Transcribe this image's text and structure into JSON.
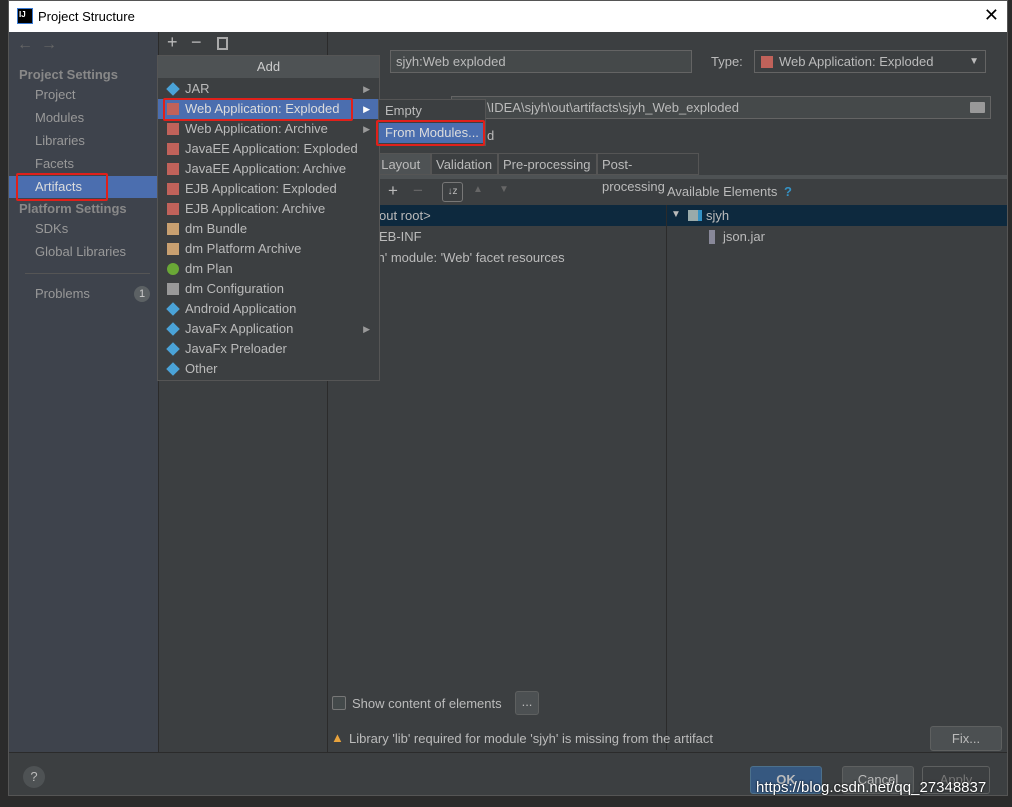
{
  "window": {
    "title": "Project Structure",
    "close": "✕"
  },
  "sidebar": {
    "project_settings": "Project Settings",
    "items": [
      "Project",
      "Modules",
      "Libraries",
      "Facets",
      "Artifacts"
    ],
    "platform_settings": "Platform Settings",
    "platform_items": [
      "SDKs",
      "Global Libraries"
    ],
    "problems": "Problems",
    "problems_count": "1"
  },
  "menu": {
    "header": "Add",
    "items": [
      {
        "label": "JAR",
        "icon": "jar-icon",
        "arrow": true
      },
      {
        "label": "Web Application: Exploded",
        "icon": "web-app-icon",
        "arrow": true
      },
      {
        "label": "Web Application: Archive",
        "icon": "web-app-icon",
        "arrow": true
      },
      {
        "label": "JavaEE Application: Exploded",
        "icon": "javaee-icon"
      },
      {
        "label": "JavaEE Application: Archive",
        "icon": "javaee-icon"
      },
      {
        "label": "EJB Application: Exploded",
        "icon": "ejb-icon"
      },
      {
        "label": "EJB Application: Archive",
        "icon": "ejb-icon"
      },
      {
        "label": "dm Bundle",
        "icon": "dm-bundle-icon"
      },
      {
        "label": "dm Platform Archive",
        "icon": "dm-archive-icon"
      },
      {
        "label": "dm Plan",
        "icon": "dm-plan-icon"
      },
      {
        "label": "dm Configuration",
        "icon": "file-icon"
      },
      {
        "label": "Android Application",
        "icon": "jar-icon"
      },
      {
        "label": "JavaFx Application",
        "icon": "jar-icon",
        "arrow": true
      },
      {
        "label": "JavaFx Preloader",
        "icon": "jar-icon"
      },
      {
        "label": "Other",
        "icon": "jar-icon"
      }
    ],
    "submenu": [
      "Empty",
      "From Modules..."
    ]
  },
  "artifact": {
    "name": "sjyh:Web exploded",
    "type_label": "Type:",
    "type_value": "Web Application: Exploded",
    "output_dir": "\\IDEA\\sjyh\\out\\artifacts\\sjyh_Web_exploded",
    "partial": "d",
    "tabs": [
      "t Layout",
      "Validation",
      "Pre-processing",
      "Post-processing"
    ],
    "available_elements": "Available Elements",
    "help": "?",
    "tree_left": [
      "out root>",
      "EB-INF",
      "yh' module: 'Web' facet resources"
    ],
    "tree_right": [
      "sjyh",
      "json.jar"
    ],
    "show_content": "Show content of elements",
    "more": "...",
    "warning": "Library 'lib' required for module 'sjyh' is missing from the artifact",
    "fix": "Fix..."
  },
  "footer": {
    "help": "?",
    "ok": "OK",
    "cancel": "Cancel",
    "apply": "Apply"
  },
  "watermark": "https://blog.csdn.net/qq_27348837",
  "colors": {
    "selection": "#4b6eaf",
    "highlight_box": "#e0201a",
    "background": "#3c3f41"
  }
}
